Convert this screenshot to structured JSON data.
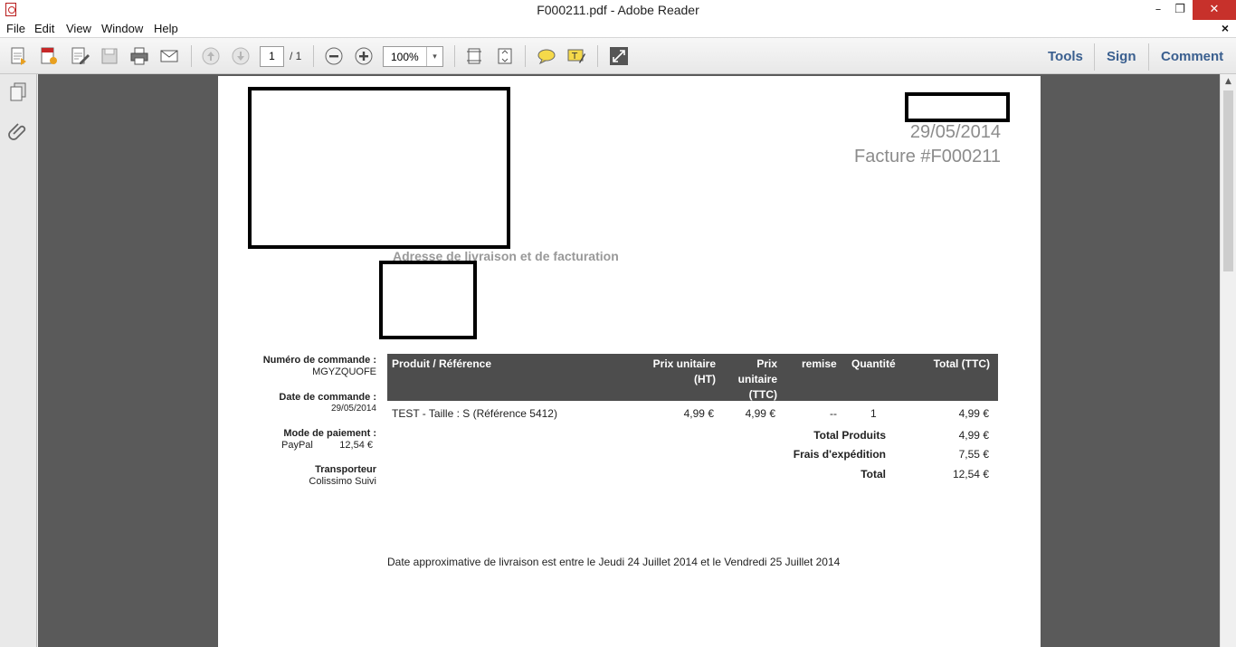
{
  "window": {
    "title": "F000211.pdf - Adobe Reader",
    "min": "–",
    "max": "❐",
    "close": "✕"
  },
  "menu": {
    "items": [
      "File",
      "Edit",
      "View",
      "Window",
      "Help"
    ],
    "close": "×"
  },
  "toolbar": {
    "page_current": "1",
    "page_total": "/ 1",
    "zoom": "100%",
    "zoom_arrow": "▾",
    "links": [
      "Tools",
      "Sign",
      "Comment"
    ]
  },
  "invoice": {
    "date": "29/05/2014",
    "number": "Facture #F000211",
    "address_title": "Adresse de livraison et de facturation",
    "meta": {
      "order_label": "Numéro de commande :",
      "order_value": "MGYZQUOFE",
      "date_label": "Date de commande :",
      "date_value": "29/05/2014",
      "payment_label": "Mode de paiement :",
      "payment_method": "PayPal",
      "payment_amount": "12,54 €",
      "carrier_label": "Transporteur",
      "carrier_value": "Colissimo Suivi"
    },
    "table": {
      "headers": {
        "product": "Produit / Référence",
        "unit_ht_1": "Prix unitaire",
        "unit_ht_2": "(HT)",
        "unit_ttc_1": "Prix",
        "unit_ttc_2": "unitaire",
        "unit_ttc_3": "(TTC)",
        "discount": "remise",
        "quantity": "Quantité",
        "total": "Total (TTC)"
      },
      "row": {
        "product": "TEST - Taille : S (Référence 5412)",
        "unit_ht": "4,99 €",
        "unit_ttc": "4,99 €",
        "discount": "--",
        "quantity": "1",
        "total": "4,99 €"
      },
      "totals": {
        "products_label": "Total Produits",
        "products_value": "4,99 €",
        "shipping_label": "Frais d'expédition",
        "shipping_value": "7,55 €",
        "total_label": "Total",
        "total_value": "12,54 €"
      }
    },
    "delivery_note": "Date approximative de livraison est entre le Jeudi 24 Juillet 2014 et le Vendredi 25 Juillet 2014"
  }
}
